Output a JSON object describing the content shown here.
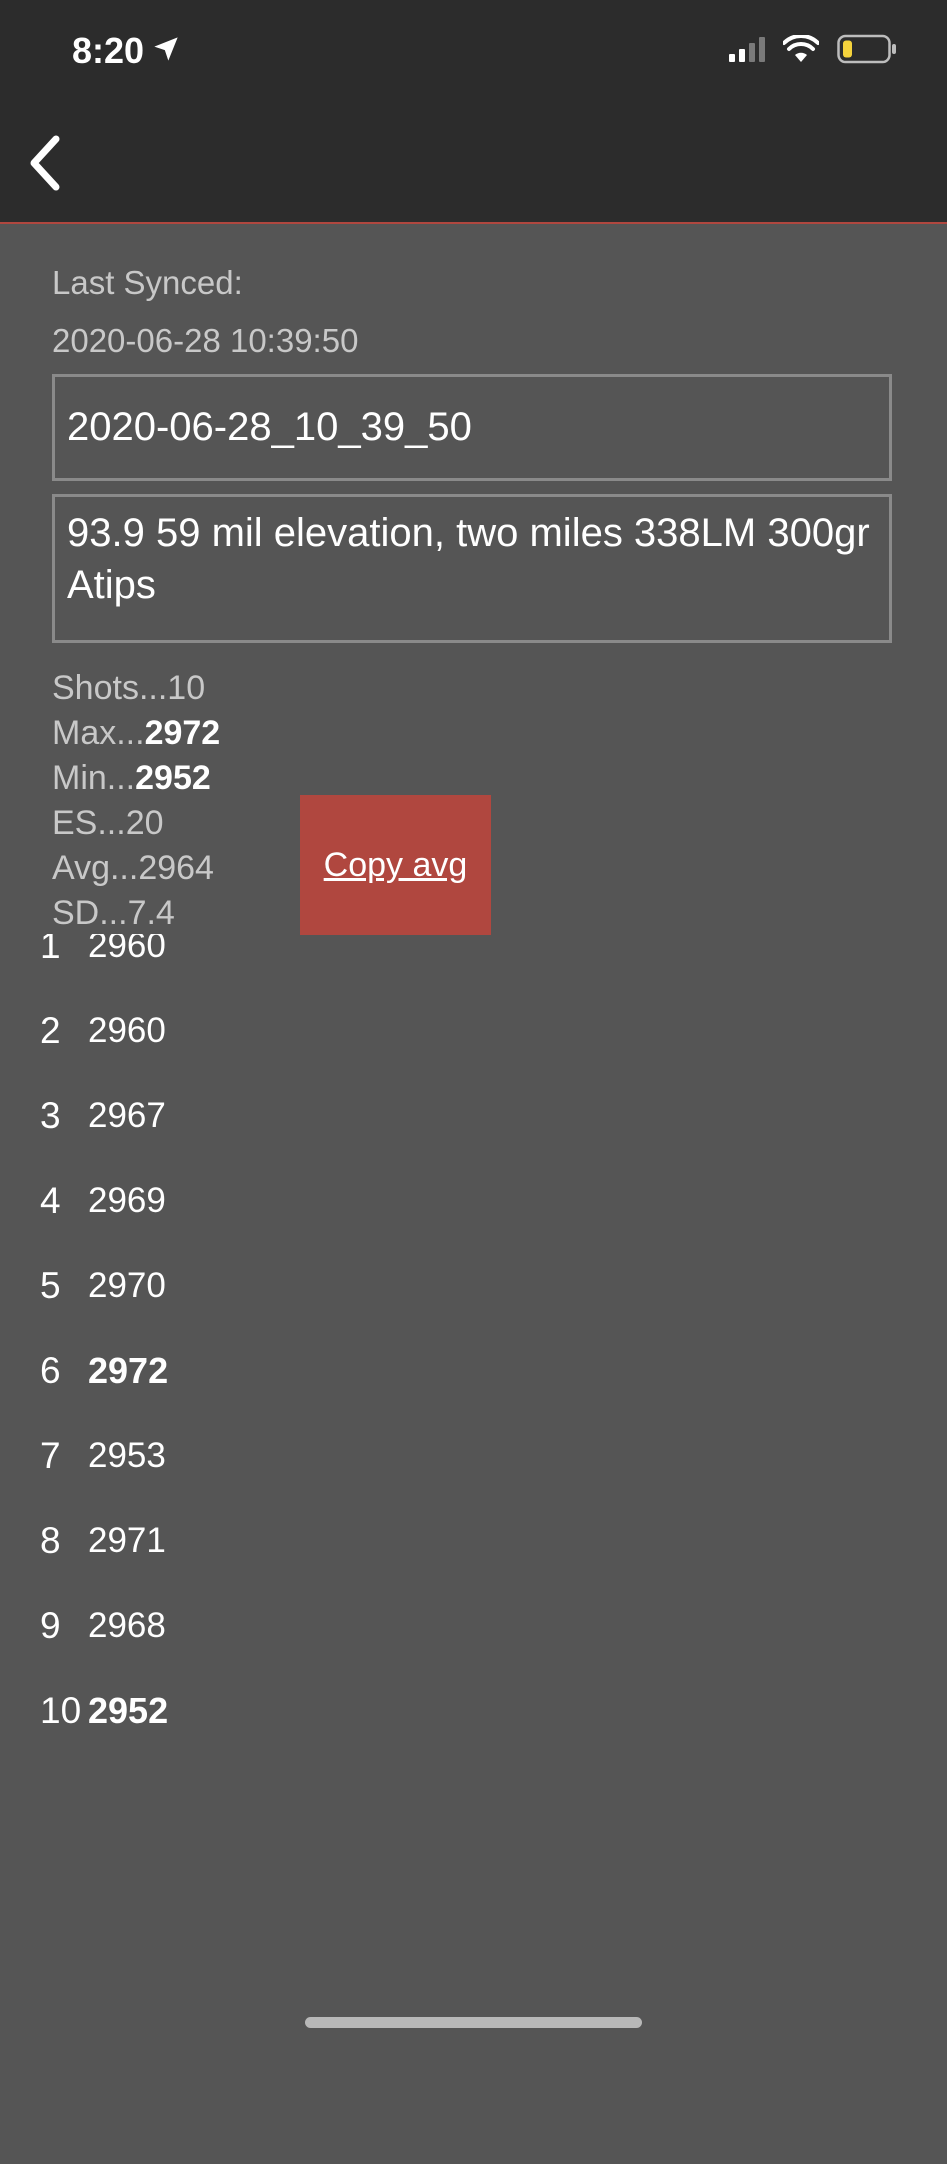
{
  "status_bar": {
    "time": "8:20",
    "icons": [
      "location-arrow-icon",
      "cellular-signal-icon",
      "wifi-icon",
      "battery-icon"
    ]
  },
  "nav": {
    "back_icon": "chevron-left-icon"
  },
  "sync": {
    "label": "Last Synced:",
    "value": "2020-06-28 10:39:50"
  },
  "session": {
    "name": "2020-06-28_10_39_50",
    "notes": "93.9 59 mil elevation, two miles 338LM 300gr Atips"
  },
  "stats": {
    "shots_label": "Shots...",
    "shots_value": "10",
    "max_label": "Max...",
    "max_value": "2972",
    "min_label": "Min...",
    "min_value": "2952",
    "es_label": "ES...",
    "es_value": "20",
    "avg_label": "Avg...",
    "avg_value": "2964",
    "sd_label": "SD...",
    "sd_value": "7.4"
  },
  "copy_button": {
    "label": "Copy avg"
  },
  "shots": [
    {
      "num": "1",
      "value": "2960",
      "bold": false
    },
    {
      "num": "2",
      "value": "2960",
      "bold": false
    },
    {
      "num": "3",
      "value": "2967",
      "bold": false
    },
    {
      "num": "4",
      "value": "2969",
      "bold": false
    },
    {
      "num": "5",
      "value": "2970",
      "bold": false
    },
    {
      "num": "6",
      "value": "2972",
      "bold": true
    },
    {
      "num": "7",
      "value": "2953",
      "bold": false
    },
    {
      "num": "8",
      "value": "2971",
      "bold": false
    },
    {
      "num": "9",
      "value": "2968",
      "bold": false
    },
    {
      "num": "10",
      "value": "2952",
      "bold": true
    }
  ],
  "colors": {
    "header_bg": "#2c2c2c",
    "body_bg": "#555555",
    "accent": "#b0473f",
    "battery_low": "#f5d33c"
  }
}
